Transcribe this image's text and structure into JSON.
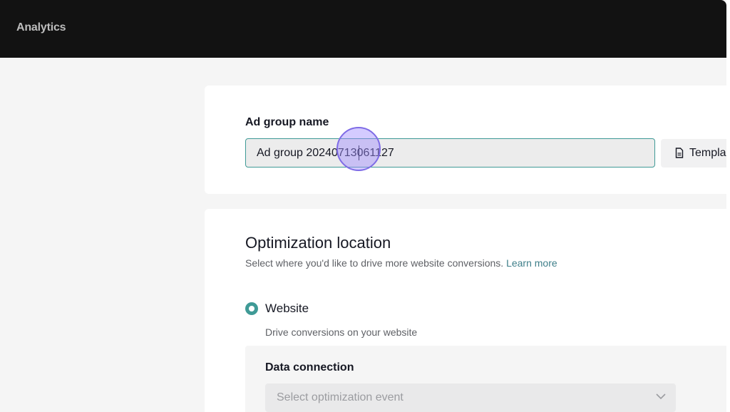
{
  "header": {
    "brand": "Analytics"
  },
  "ad_group": {
    "label": "Ad group name",
    "value": "Ad group 20240713061127",
    "template_button": "Templa"
  },
  "optimization": {
    "title": "Optimization location",
    "description": "Select where you'd like to drive more website conversions.",
    "learn_more": "Learn more",
    "option": {
      "label": "Website",
      "sublabel": "Drive conversions on your website",
      "selected": true
    },
    "data_connection": {
      "title": "Data connection",
      "placeholder": "Select optimization event"
    }
  },
  "colors": {
    "accent": "#3f9a96",
    "topbar": "#121212",
    "link": "#3f7f8a"
  },
  "icons": [
    "document-icon",
    "chevron-down-icon"
  ]
}
